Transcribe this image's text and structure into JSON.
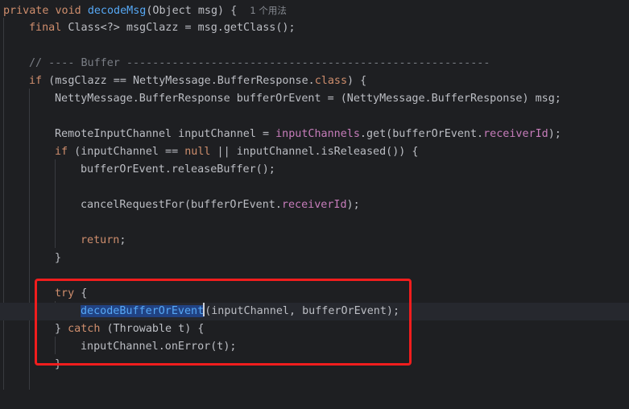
{
  "code": {
    "l1": {
      "kw1": "private",
      "kw2": "void",
      "method": "decodeMsg",
      "rest": "(Object msg) {",
      "usage_hint": "1 个用法"
    },
    "l2": {
      "kw": "final",
      "rest": "Class<?> msgClazz = msg.getClass();"
    },
    "l3": {
      "comment": "// ---- Buffer --------------------------------------------------------"
    },
    "l4": {
      "kw": "if",
      "rest1": " (msgClazz == NettyMessage.BufferResponse.",
      "kw2": "class",
      "rest2": ") {"
    },
    "l5": {
      "text": "NettyMessage.BufferResponse bufferOrEvent = (NettyMessage.BufferResponse) msg;"
    },
    "l6": {
      "pre": "RemoteInputChannel inputChannel = ",
      "field1": "inputChannels",
      "mid": ".get(bufferOrEvent.",
      "field2": "receiverId",
      "post": ");"
    },
    "l7": {
      "kw": "if",
      "pre": " (inputChannel == ",
      "kw2": "null",
      "post": " || inputChannel.isReleased()) {"
    },
    "l8": {
      "text": "bufferOrEvent.releaseBuffer();"
    },
    "l9": {
      "pre": "cancelRequestFor(bufferOrEvent.",
      "field": "receiverId",
      "post": ");"
    },
    "l10": {
      "kw": "return",
      "post": ";"
    },
    "l11": {
      "text": "}"
    },
    "l12": {
      "kw": "try",
      "post": " {"
    },
    "l13": {
      "selected": "decodeBufferOrEvent",
      "post": "(inputChannel, bufferOrEvent);"
    },
    "l14": {
      "pre": "} ",
      "kw": "catch",
      "post": " (Throwable t) {"
    },
    "l15": {
      "text": "inputChannel.onError(t);"
    },
    "l16": {
      "text": "}"
    }
  },
  "colors": {
    "background": "#1e1f22",
    "keyword": "#cf8e6d",
    "method": "#56a8f5",
    "field": "#c77dbb",
    "comment": "#7a7e85",
    "highlight_box": "#f11d1d",
    "selection": "#214283"
  }
}
